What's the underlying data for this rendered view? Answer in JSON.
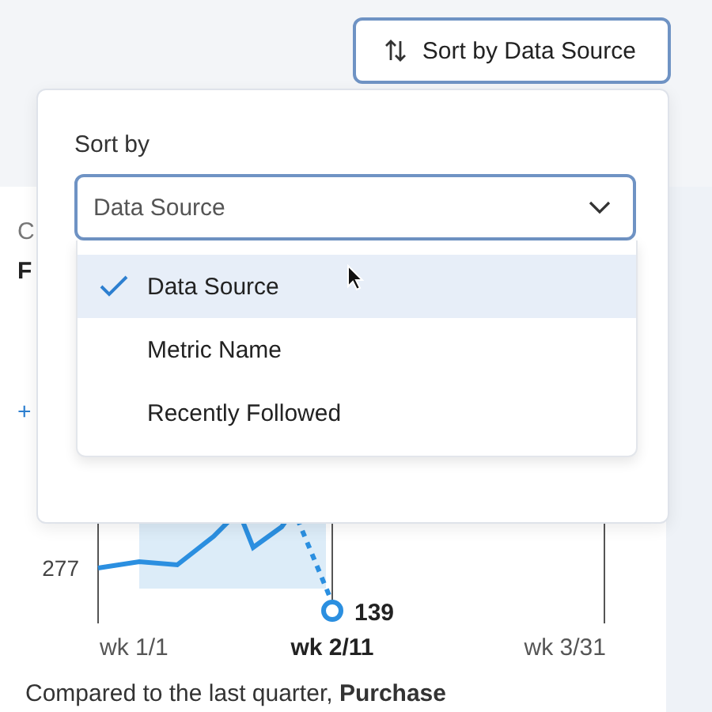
{
  "sort_button": {
    "label": "Sort by Data Source"
  },
  "card": {
    "title_fragment": "C",
    "subtitle_fragment": "F",
    "add_fragment": "+"
  },
  "chart": {
    "y_label": "277",
    "point_label": "139",
    "x_labels": [
      {
        "label": "wk 1/1",
        "selected": false
      },
      {
        "label": "wk 2/11",
        "selected": true
      },
      {
        "label": "wk 3/31",
        "selected": false
      }
    ]
  },
  "summary": "Compared to the last quarter, **Purchase**",
  "popover": {
    "label": "Sort by",
    "select": {
      "value": "Data Source",
      "expanded": true
    },
    "options": [
      {
        "label": "Data Source",
        "selected": true
      },
      {
        "label": "Metric Name",
        "selected": false
      },
      {
        "label": "Recently Followed",
        "selected": false
      }
    ]
  }
}
